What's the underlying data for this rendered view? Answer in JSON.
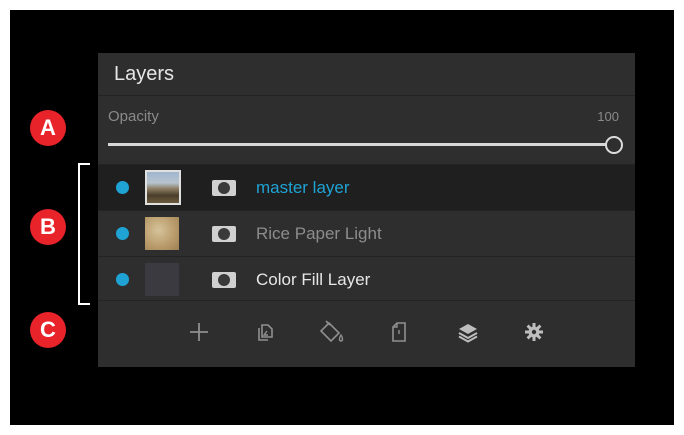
{
  "callouts": {
    "a": "A",
    "b": "B",
    "c": "C"
  },
  "panel": {
    "title": "Layers",
    "opacity": {
      "label": "Opacity",
      "value": "100",
      "level": 1.0
    },
    "layers": [
      {
        "name": "master layer",
        "thumbnail": "photo",
        "visible": true,
        "selected": true,
        "name_color": "#1fa3d4"
      },
      {
        "name": "Rice Paper Light",
        "thumbnail": "paper-texture",
        "visible": true,
        "selected": false,
        "name_color": "#8c8c8c"
      },
      {
        "name": "Color Fill Layer",
        "thumbnail": "color-fill",
        "visible": true,
        "selected": false,
        "name_color": "#e6e6e6"
      }
    ],
    "toolbar": [
      "add-layer-icon",
      "duplicate-layer-icon",
      "fill-bucket-icon",
      "new-document-icon",
      "layer-stack-icon",
      "settings-gear-icon"
    ]
  },
  "colors": {
    "accent": "#1fa3d4",
    "callout": "#e8242a",
    "panel_bg": "#2e2e2e",
    "selected_row_bg": "#1f1f1f"
  }
}
